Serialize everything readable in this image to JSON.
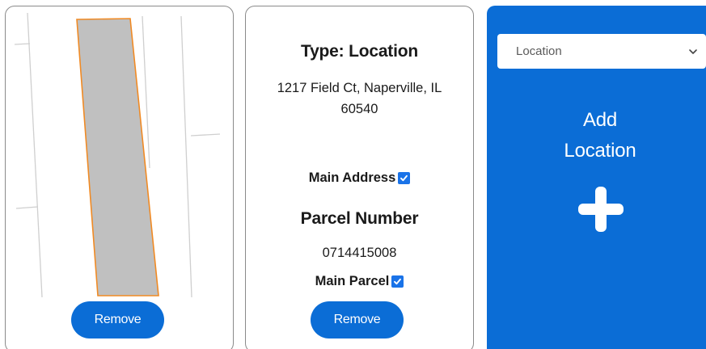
{
  "map_card": {
    "remove_label": "Remove",
    "icons": {
      "parcel": "parcel-outline-shape"
    },
    "colors": {
      "parcel_fill": "#c0c0c0",
      "parcel_outline": "#f08a24"
    }
  },
  "location_card": {
    "type_label": "Type: Location",
    "address_line1": "1217 Field Ct, Naperville, IL",
    "address_line2": "60540",
    "main_address_label": "Main Address",
    "main_address_checked": true,
    "parcel_heading": "Parcel Number",
    "parcel_number": "0714415008",
    "main_parcel_label": "Main Parcel",
    "main_parcel_checked": true,
    "remove_label": "Remove",
    "icons": {
      "checkbox": "checkmark-icon"
    }
  },
  "add_card": {
    "select_value": "Location",
    "add_line1": "Add",
    "add_line2": "Location",
    "icons": {
      "select": "chevron-down-icon",
      "add": "plus-icon"
    },
    "colors": {
      "background": "#0b6dd6",
      "accent": "#1a73e8"
    }
  }
}
